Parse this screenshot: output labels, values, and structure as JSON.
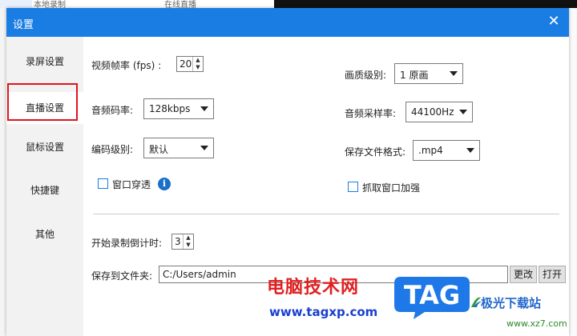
{
  "background": {
    "text_left": "本地录制",
    "text_mid": "在线直播"
  },
  "dialog": {
    "title": "设置",
    "close_glyph": "✕"
  },
  "sidebar": {
    "items": [
      {
        "label": "录屏设置"
      },
      {
        "label": "直播设置"
      },
      {
        "label": "鼠标设置"
      },
      {
        "label": "快捷键"
      },
      {
        "label": "其他"
      }
    ],
    "active_index": 1
  },
  "settings": {
    "fps_label": "视频帧率 (fps) :",
    "fps_value": "20",
    "quality_label": "画质级别:",
    "quality_value": "1 原画",
    "bitrate_label": "音频码率:",
    "bitrate_value": "128kbps",
    "samplerate_label": "音频采样率:",
    "samplerate_value": "44100Hz",
    "encode_label": "编码级别:",
    "encode_value": "默认",
    "format_label": "保存文件格式:",
    "format_value": ".mp4",
    "window_through_label": "窗口穿透",
    "window_through_checked": false,
    "capture_enhance_label": "抓取窗口加强",
    "capture_enhance_checked": false,
    "countdown_label": "开始录制倒计时:",
    "countdown_value": "3",
    "save_folder_label": "保存到文件夹:",
    "save_folder_value": "C:/Users/admin",
    "change_button": "更改",
    "open_button": "打开"
  },
  "watermark": {
    "cn_text": "电脑技术网",
    "url": "www.tagxp.com",
    "logo_text": "TAG",
    "site_name": "极光下载站",
    "site_url": "www.xz7.com"
  },
  "colors": {
    "titlebar": "#1a7de3",
    "highlight": "#e0151d",
    "tag_blue": "#1f78e8"
  }
}
